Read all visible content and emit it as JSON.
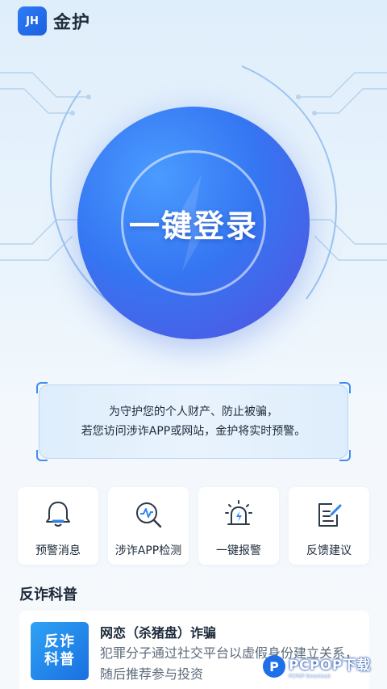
{
  "header": {
    "logo_text": "JH",
    "app_name": "金护"
  },
  "hero": {
    "login_label": "一键登录"
  },
  "notice": {
    "line1": "为守护您的个人财产、防止被骗，",
    "line2": "若您访问涉诈APP或网站，金护将实时预警。"
  },
  "features": [
    {
      "label": "预警消息",
      "icon": "bell-icon"
    },
    {
      "label": "涉诈APP检测",
      "icon": "search-pulse-icon"
    },
    {
      "label": "一键报警",
      "icon": "siren-icon"
    },
    {
      "label": "反馈建议",
      "icon": "edit-note-icon"
    }
  ],
  "section": {
    "title": "反诈科普"
  },
  "article": {
    "thumb_line1": "反诈",
    "thumb_line2": "科普",
    "title": "网恋（杀猪盘）诈骗",
    "desc": "犯罪分子通过社交平台以虚假身份建立关系，随后推荐参与投资"
  },
  "watermark": {
    "logo": "P",
    "main": "PCPOP下载",
    "sub": "PCPOP Download"
  },
  "colors": {
    "accent": "#3576f2",
    "background": "#eaf4fc"
  }
}
